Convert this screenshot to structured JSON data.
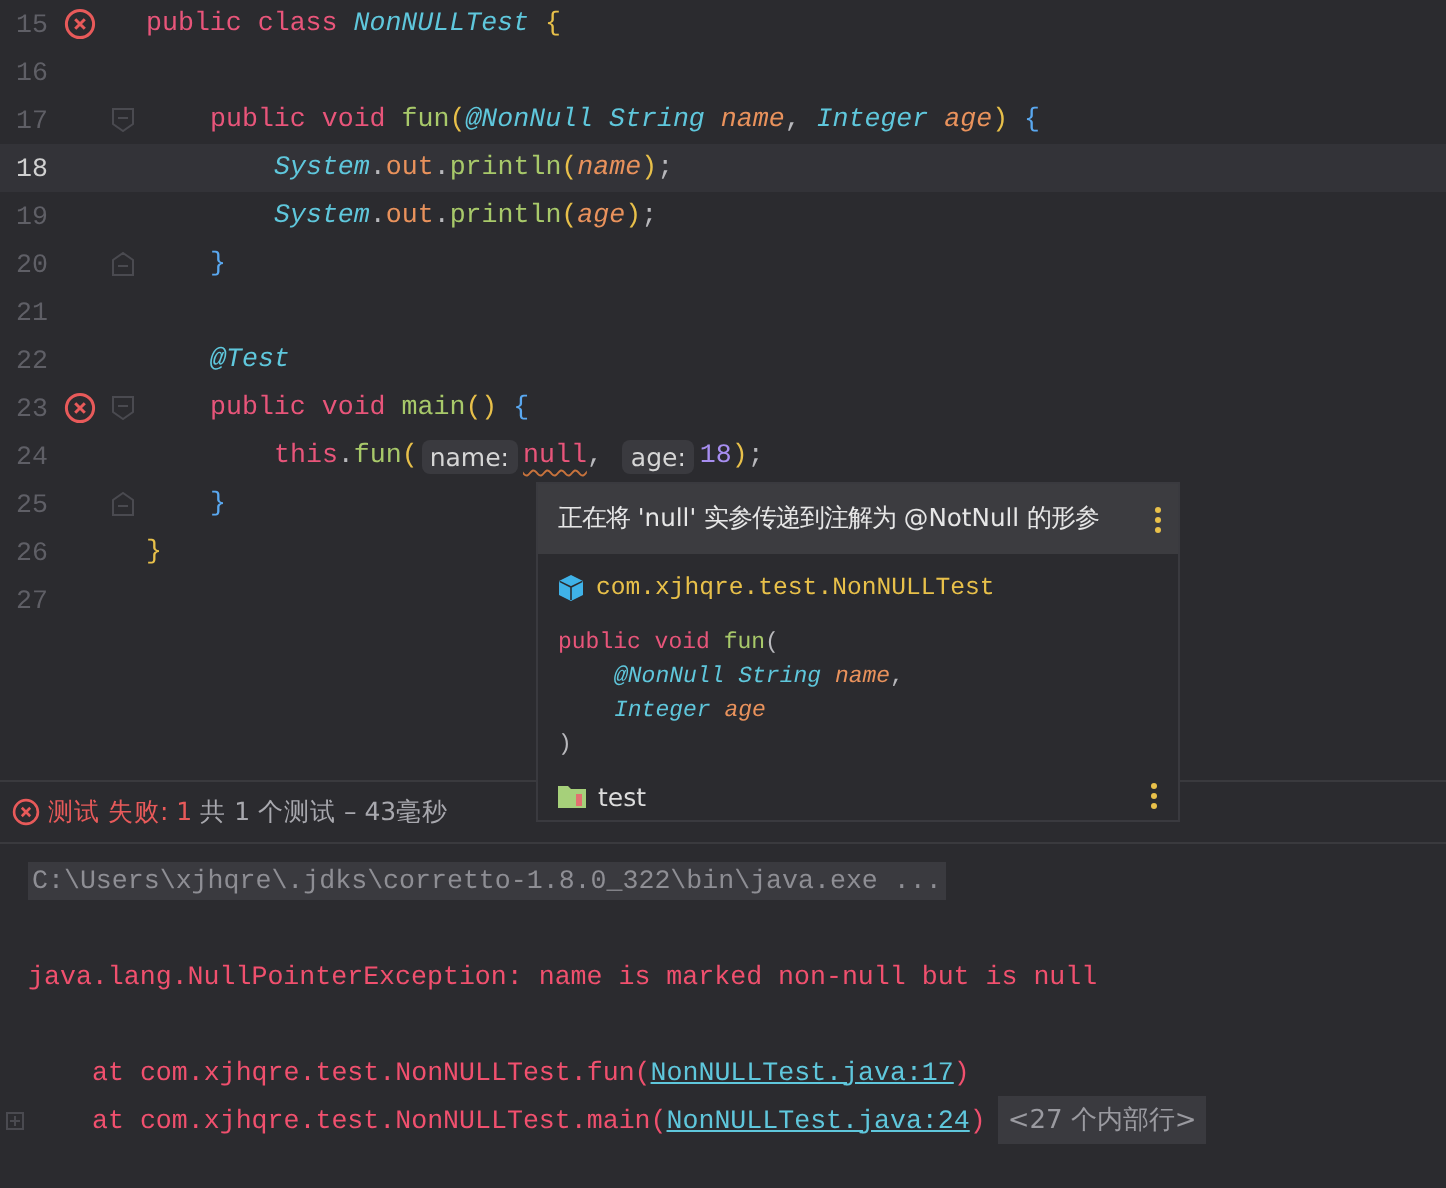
{
  "editor": {
    "lines": [
      {
        "number": "15",
        "current": false,
        "error": true,
        "foldable": false,
        "tokens": [
          {
            "kind": "kw",
            "text": "public class "
          },
          {
            "kind": "type",
            "text": "NonNULLTest "
          },
          {
            "kind": "bracket1",
            "text": "{"
          }
        ],
        "children": [
          {
            "number": "16",
            "current": false,
            "error": false
          },
          {
            "number": "17",
            "current": false,
            "error": false,
            "foldable": true,
            "tokens": [
              {
                "kind": "kw",
                "text": "public void "
              },
              {
                "kind": "method",
                "text": "fun"
              },
              {
                "kind": "bracket1",
                "text": "("
              },
              {
                "kind": "annot",
                "text": "@NonNull "
              },
              {
                "kind": "type",
                "text": "String "
              },
              {
                "kind": "param",
                "text": "name"
              },
              {
                "kind": "plain",
                "text": ", "
              },
              {
                "kind": "type",
                "text": "Integer "
              },
              {
                "kind": "param",
                "text": "age"
              },
              {
                "kind": "bracket1",
                "text": ") "
              },
              {
                "kind": "bracket2",
                "text": "{"
              }
            ],
            "children": [
              {
                "number": "18",
                "current": true,
                "error": false,
                "tokens": [
                  {
                    "kind": "type",
                    "text": "System"
                  },
                  {
                    "kind": "plain",
                    "text": "."
                  },
                  {
                    "kind": "field",
                    "text": "out"
                  },
                  {
                    "kind": "plain",
                    "text": "."
                  },
                  {
                    "kind": "method",
                    "text": "println"
                  },
                  {
                    "kind": "bracket1",
                    "text": "("
                  },
                  {
                    "kind": "param",
                    "text": "name"
                  },
                  {
                    "kind": "bracket1",
                    "text": ")"
                  },
                  {
                    "kind": "plain",
                    "text": ";"
                  }
                ]
              },
              {
                "number": "19",
                "current": false,
                "error": false,
                "tokens": [
                  {
                    "kind": "type",
                    "text": "System"
                  },
                  {
                    "kind": "plain",
                    "text": "."
                  },
                  {
                    "kind": "field",
                    "text": "out"
                  },
                  {
                    "kind": "plain",
                    "text": "."
                  },
                  {
                    "kind": "method",
                    "text": "println"
                  },
                  {
                    "kind": "bracket1",
                    "text": "("
                  },
                  {
                    "kind": "param",
                    "text": "age"
                  },
                  {
                    "kind": "bracket1",
                    "text": ")"
                  },
                  {
                    "kind": "plain",
                    "text": ";"
                  }
                ]
              }
            ],
            "closing": {
              "number": "20",
              "current": false,
              "error": false,
              "tokens": [
                {
                  "kind": "bracket2",
                  "text": "}"
                }
              ]
            }
          },
          {
            "number": "21",
            "current": false,
            "error": false
          },
          {
            "number": "22",
            "current": false,
            "error": false,
            "tokens": [
              {
                "kind": "annot",
                "text": "@Test"
              }
            ]
          },
          {
            "number": "23",
            "current": false,
            "error": true,
            "foldable": true,
            "tokens": [
              {
                "kind": "kw",
                "text": "public void "
              },
              {
                "kind": "method",
                "text": "main"
              },
              {
                "kind": "bracket1",
                "text": "() "
              },
              {
                "kind": "bracket2",
                "text": "{"
              }
            ],
            "children": [
              {
                "number": "24",
                "current": false,
                "error": false,
                "tokens": [
                  {
                    "kind": "kw",
                    "text": "this"
                  },
                  {
                    "kind": "plain",
                    "text": "."
                  },
                  {
                    "kind": "method",
                    "text": "fun"
                  },
                  {
                    "kind": "bracket1",
                    "text": "("
                  },
                  {
                    "kind": "hint",
                    "text": "name:"
                  },
                  {
                    "kind": "warn",
                    "text": "null"
                  },
                  {
                    "kind": "plain",
                    "text": ", "
                  },
                  {
                    "kind": "hint",
                    "text": "age:"
                  },
                  {
                    "kind": "number",
                    "text": "18"
                  },
                  {
                    "kind": "bracket1",
                    "text": ")"
                  },
                  {
                    "kind": "plain",
                    "text": ";"
                  }
                ]
              }
            ],
            "closing": {
              "number": "25",
              "current": false,
              "error": false,
              "tokens": [
                {
                  "kind": "bracket2",
                  "text": "}"
                }
              ]
            }
          }
        ],
        "closing": {
          "number": "26",
          "current": false,
          "error": false,
          "tokens": [
            {
              "kind": "bracket1",
              "text": "}"
            }
          ]
        }
      },
      {
        "number": "27",
        "current": false,
        "error": false
      }
    ]
  },
  "popup": {
    "message": "正在将 'null' 实参传递到注解为 @NotNull 的形参",
    "class_name": "com.xjhqre.test.NonNULLTest",
    "signature": [
      {
        "indented": false,
        "tokens": [
          {
            "kind": "kw",
            "text": "public void "
          },
          {
            "kind": "method",
            "text": "fun"
          },
          {
            "kind": "plain",
            "text": "("
          }
        ]
      },
      {
        "indented": true,
        "tokens": [
          {
            "kind": "annot",
            "text": "@NonNull "
          },
          {
            "kind": "type",
            "text": "String "
          },
          {
            "kind": "param",
            "text": "name"
          },
          {
            "kind": "plain",
            "text": ","
          }
        ]
      },
      {
        "indented": true,
        "tokens": [
          {
            "kind": "type",
            "text": "Integer "
          },
          {
            "kind": "param",
            "text": "age"
          }
        ]
      },
      {
        "indented": false,
        "tokens": [
          {
            "kind": "plain",
            "text": ")"
          }
        ]
      }
    ],
    "module": "test"
  },
  "test_status": {
    "result": "测试 失败: 1",
    "summary": "共 1 个测试 – 43毫秒"
  },
  "console": {
    "lines": [
      {
        "kind": "command",
        "text": "C:\\Users\\xjhqre\\.jdks\\corretto-1.8.0_322\\bin\\java.exe ..."
      },
      {
        "kind": "blank"
      },
      {
        "kind": "error",
        "text": "java.lang.NullPointerException: name is marked non-null but is null"
      },
      {
        "kind": "blank"
      },
      {
        "kind": "trace",
        "text": "at com.xjhqre.test.NonNULLTest.fun(",
        "link": "NonNULLTest.java:17",
        "suffix": ")"
      },
      {
        "kind": "trace",
        "text": "at com.xjhqre.test.NonNULLTest.main(",
        "link": "NonNULLTest.java:24",
        "suffix": ")",
        "collapsed": "<27 个内部行>"
      }
    ]
  }
}
